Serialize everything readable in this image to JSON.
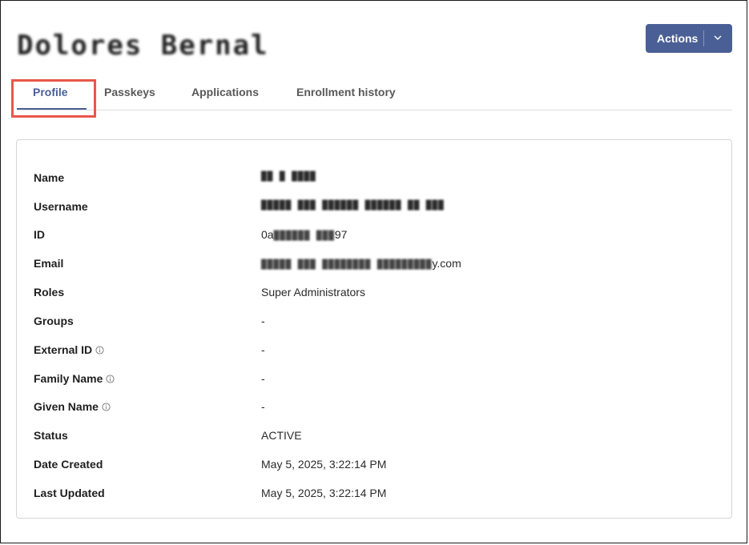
{
  "header": {
    "title": "Dolores Bernal",
    "actions_label": "Actions"
  },
  "tabs": [
    {
      "label": "Profile",
      "active": true
    },
    {
      "label": "Passkeys",
      "active": false
    },
    {
      "label": "Applications",
      "active": false
    },
    {
      "label": "Enrollment history",
      "active": false
    }
  ],
  "profile": {
    "rows": [
      {
        "label": "Name",
        "value": "██ █ ████",
        "info": false
      },
      {
        "label": "Username",
        "value": "█████ ███ ██████ ██████ ██ ███",
        "info": false
      },
      {
        "label": "ID",
        "value_prefix": "0a",
        "value_blur": "██████ ███",
        "value_suffix": "97",
        "info": false
      },
      {
        "label": "Email",
        "value_blur": "█████ ███ ████████ █████████",
        "value_suffix": "y.com",
        "info": false
      },
      {
        "label": "Roles",
        "value": "Super Administrators",
        "info": false
      },
      {
        "label": "Groups",
        "value": "-",
        "info": false
      },
      {
        "label": "External ID",
        "value": "-",
        "info": true
      },
      {
        "label": "Family Name",
        "value": "-",
        "info": true
      },
      {
        "label": "Given Name",
        "value": "-",
        "info": true
      },
      {
        "label": "Status",
        "value": "ACTIVE",
        "info": false
      },
      {
        "label": "Date Created",
        "value": "May 5, 2025, 3:22:14 PM",
        "info": false
      },
      {
        "label": "Last Updated",
        "value": "May 5, 2025, 3:22:14 PM",
        "info": false
      }
    ]
  },
  "colors": {
    "accent": "#4a5f95",
    "highlight": "#e8574a",
    "border": "#d6d6d6"
  }
}
